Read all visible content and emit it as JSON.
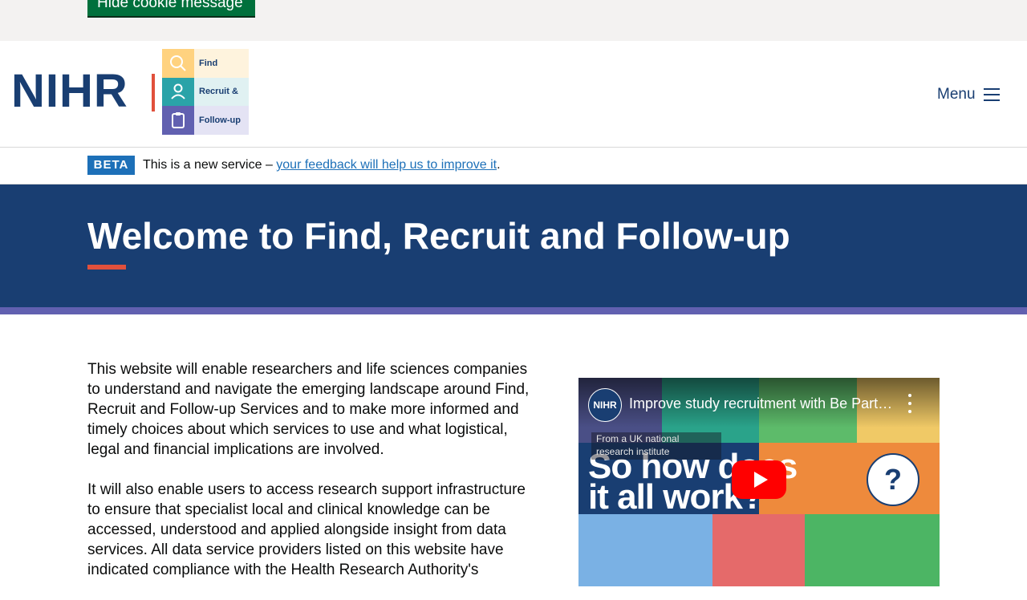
{
  "cookie": {
    "hide_label": "Hide cookie message"
  },
  "header": {
    "brand": "NIHR",
    "logo_items": [
      {
        "label": "Find",
        "icon": "search-icon",
        "color": "#ffd27f",
        "bg": "#fef3dd"
      },
      {
        "label": "Recruit &",
        "icon": "person-icon",
        "color": "#2aa3a8",
        "bg": "#e0f1f2"
      },
      {
        "label": "Follow-up",
        "icon": "clipboard-icon",
        "color": "#6160b0",
        "bg": "#e4e3f4"
      }
    ],
    "menu_label": "Menu",
    "menu_icon": "hamburger-icon"
  },
  "beta": {
    "tag": "BETA",
    "text_before": "This is a new service – ",
    "link_text": "your feedback will help us to improve it",
    "text_after": "."
  },
  "hero": {
    "title": "Welcome to Find, Recruit and Follow-up"
  },
  "main": {
    "paragraphs": [
      "This website will enable researchers and life sciences companies to understand and navigate the emerging landscape around Find, Recruit and Follow-up Services and to make more informed and timely choices about which services to use and what logistical, legal and financial implications are involved.",
      "It will also enable users to access research support infrastructure to ensure that specialist local and clinical knowledge can be accessed, understood and applied alongside insight from data services. All data service providers listed on this website have indicated compliance with the Health Research Authority's"
    ]
  },
  "video": {
    "channel": "NIHR",
    "title": "Improve study recruitment with Be Part of Research",
    "info": "From a UK national research institute",
    "headline_1": "So how does",
    "headline_2": "it all work?",
    "question_mark": "?"
  },
  "colors": {
    "brand_navy": "#193e72",
    "accent_red": "#e1503c",
    "stripe_purple": "#6160b0",
    "cookie_green": "#00703c",
    "link_blue": "#1d70b8"
  }
}
